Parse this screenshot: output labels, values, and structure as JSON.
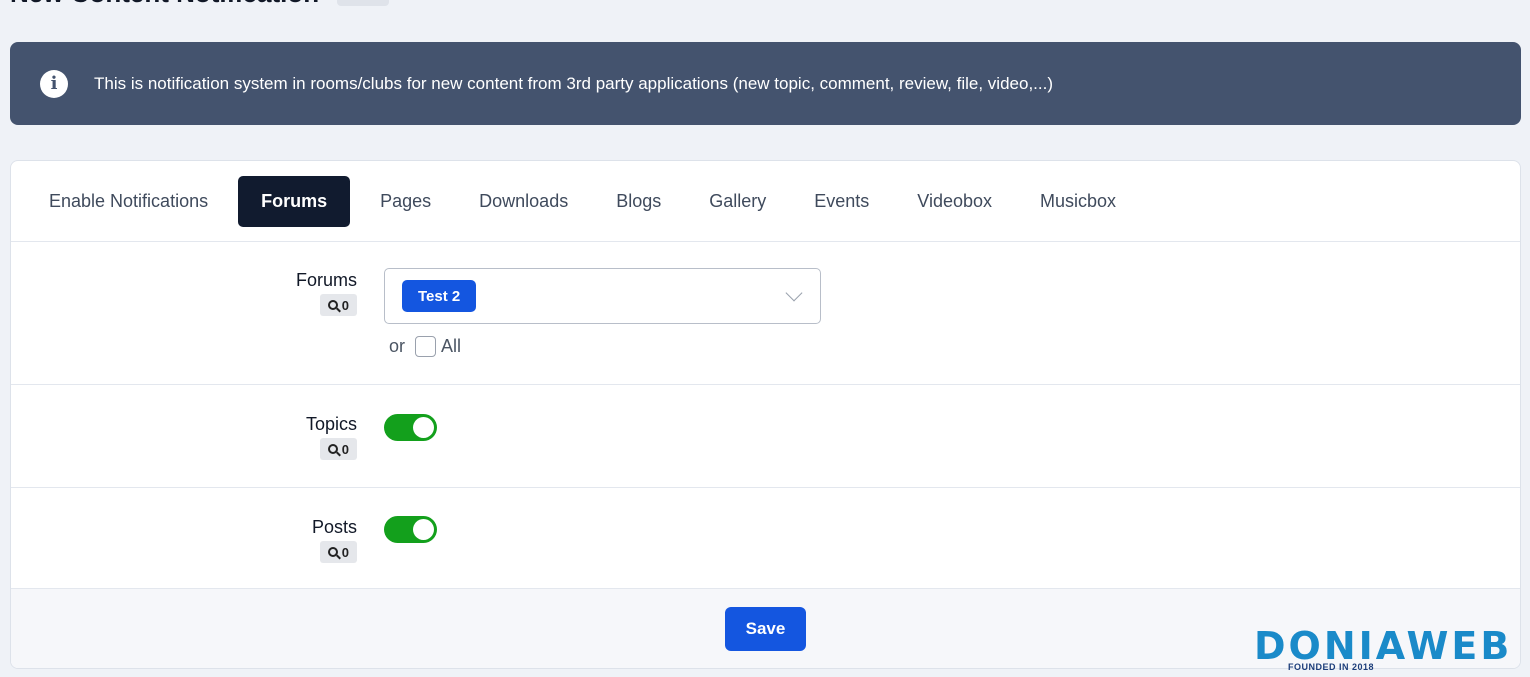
{
  "page": {
    "title": "New Content Notification",
    "info_text": "This is notification system in rooms/clubs for new content from 3rd party applications (new topic, comment, review, file, video,...)"
  },
  "tabs": [
    {
      "label": "Enable Notifications",
      "active": false
    },
    {
      "label": "Forums",
      "active": true
    },
    {
      "label": "Pages",
      "active": false
    },
    {
      "label": "Downloads",
      "active": false
    },
    {
      "label": "Blogs",
      "active": false
    },
    {
      "label": "Gallery",
      "active": false
    },
    {
      "label": "Events",
      "active": false
    },
    {
      "label": "Videobox",
      "active": false
    },
    {
      "label": "Musicbox",
      "active": false
    }
  ],
  "form": {
    "forums": {
      "label": "Forums",
      "count": "0",
      "selected": [
        "Test 2"
      ],
      "or_text": "or",
      "all_label": "All",
      "all_checked": false
    },
    "topics": {
      "label": "Topics",
      "count": "0",
      "enabled": true
    },
    "posts": {
      "label": "Posts",
      "count": "0",
      "enabled": true
    }
  },
  "footer": {
    "save_label": "Save"
  },
  "watermark": {
    "brand": "DONIAWEB",
    "tagline": "FOUNDED IN 2018"
  },
  "colors": {
    "banner": "#44536e",
    "active_tab": "#111b2f",
    "primary": "#1456e0",
    "toggle_on": "#13a01c"
  },
  "icons": [
    "info-icon",
    "search-icon",
    "chevron-down-icon"
  ]
}
